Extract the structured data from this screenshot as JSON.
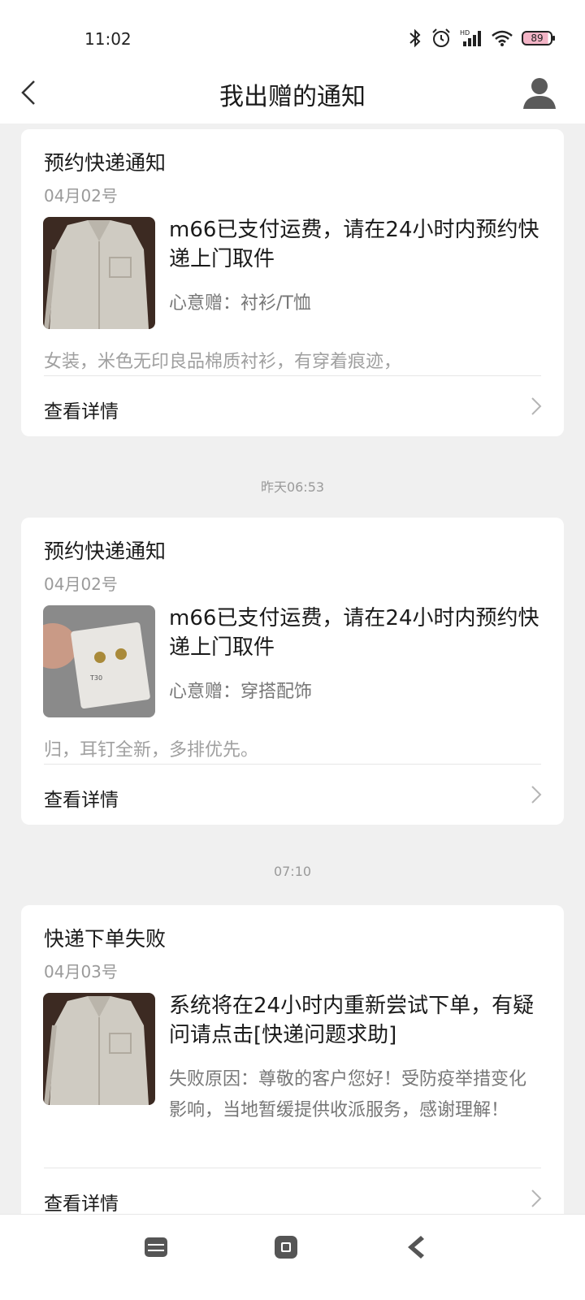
{
  "status_bar": {
    "time": "11:02",
    "battery": "89"
  },
  "header": {
    "title": "我出赠的通知"
  },
  "cards": [
    {
      "title": "预约快递通知",
      "date": "04月02号",
      "message": "m66已支付运费，请在24小时内预约快递上门取件",
      "sub": "心意赠：衬衫/T恤",
      "desc": "女装，米色无印良品棉质衬衫，有穿着痕迹，",
      "detail": "查看详情",
      "thumb": "shirt"
    },
    {
      "title": "预约快递通知",
      "date": "04月02号",
      "message": "m66已支付运费，请在24小时内预约快递上门取件",
      "sub": "心意赠：穿搭配饰",
      "desc": "归，耳钉全新，多排优先。",
      "detail": "查看详情",
      "thumb": "earrings"
    },
    {
      "title": "快递下单失败",
      "date": "04月03号",
      "message": "系统将在24小时内重新尝试下单，有疑问请点击[快递问题求助]",
      "sub": "失败原因：尊敬的客户您好！受防疫举措变化影响，当地暂缓提供收派服务，感谢理解！",
      "detail": "查看详情",
      "thumb": "shirt"
    }
  ],
  "timestamps": [
    "昨天06:53",
    "07:10"
  ]
}
